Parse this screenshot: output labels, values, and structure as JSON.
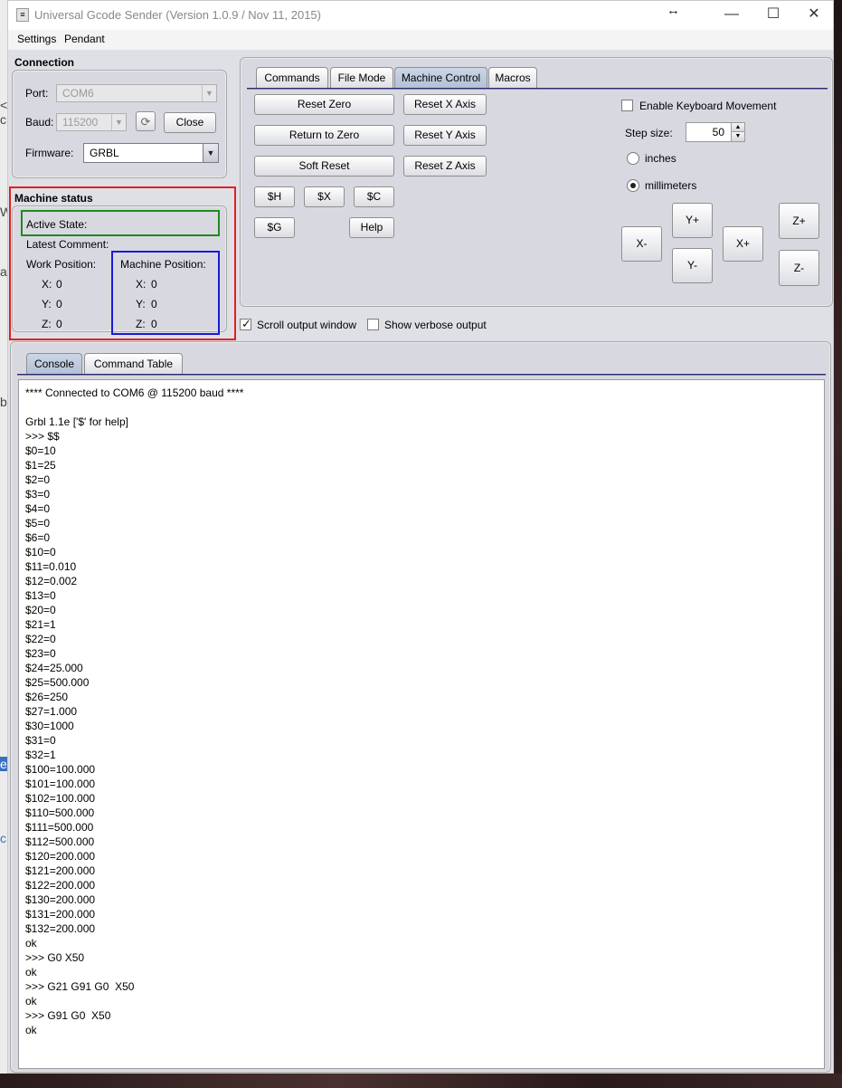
{
  "window": {
    "title": "Universal Gcode Sender (Version 1.0.9 / Nov 11, 2015)",
    "app_icon": "gcode-sender-app-icon",
    "controls": {
      "resize_glyph": "↔",
      "minimize": "—",
      "maximize": "☐",
      "close": "✕"
    }
  },
  "menu": {
    "items": [
      "Settings",
      "Pendant"
    ]
  },
  "connection": {
    "title": "Connection",
    "port_label": "Port:",
    "port_value": "COM6",
    "baud_label": "Baud:",
    "baud_value": "115200",
    "refresh_icon": "refresh-icon",
    "close_button": "Close",
    "firmware_label": "Firmware:",
    "firmware_value": "GRBL"
  },
  "machine_status": {
    "title": "Machine status",
    "active_state_label": "Active State:",
    "latest_comment_label": "Latest Comment:",
    "work_position_label": "Work Position:",
    "machine_position_label": "Machine Position:",
    "work": {
      "x_label": "X:",
      "x": "0",
      "y_label": "Y:",
      "y": "0",
      "z_label": "Z:",
      "z": "0"
    },
    "machine": {
      "x_label": "X:",
      "x": "0",
      "y_label": "Y:",
      "y": "0",
      "z_label": "Z:",
      "z": "0"
    }
  },
  "control_tabs": [
    "Commands",
    "File Mode",
    "Machine Control",
    "Macros"
  ],
  "machine_control": {
    "reset_zero": "Reset Zero",
    "return_to_zero": "Return to Zero",
    "soft_reset": "Soft Reset",
    "reset_x": "Reset X Axis",
    "reset_y": "Reset Y Axis",
    "reset_z": "Reset Z Axis",
    "cmd_h": "$H",
    "cmd_x": "$X",
    "cmd_c": "$C",
    "cmd_g": "$G",
    "help": "Help",
    "enable_keyboard": "Enable Keyboard Movement",
    "step_size_label": "Step size:",
    "step_size_value": "50",
    "unit_inches": "inches",
    "unit_mm": "millimeters",
    "jog": {
      "x_minus": "X-",
      "x_plus": "X+",
      "y_plus": "Y+",
      "y_minus": "Y-",
      "z_plus": "Z+",
      "z_minus": "Z-"
    }
  },
  "output_options": {
    "scroll_output": "Scroll output window",
    "verbose_output": "Show verbose output"
  },
  "console_tabs": [
    "Console",
    "Command Table"
  ],
  "console_lines": [
    "**** Connected to COM6 @ 115200 baud ****",
    "",
    "Grbl 1.1e ['$' for help]",
    ">>> $$",
    "$0=10",
    "$1=25",
    "$2=0",
    "$3=0",
    "$4=0",
    "$5=0",
    "$6=0",
    "$10=0",
    "$11=0.010",
    "$12=0.002",
    "$13=0",
    "$20=0",
    "$21=1",
    "$22=0",
    "$23=0",
    "$24=25.000",
    "$25=500.000",
    "$26=250",
    "$27=1.000",
    "$30=1000",
    "$31=0",
    "$32=1",
    "$100=100.000",
    "$101=100.000",
    "$102=100.000",
    "$110=500.000",
    "$111=500.000",
    "$112=500.000",
    "$120=200.000",
    "$121=200.000",
    "$122=200.000",
    "$130=200.000",
    "$131=200.000",
    "$132=200.000",
    "ok",
    ">>> G0 X50",
    "ok",
    ">>> G21 G91 G0  X50",
    "ok",
    ">>> G91 G0  X50",
    "ok"
  ],
  "background_fragments": [
    "< c",
    "W",
    "a",
    "b",
    "er",
    "c"
  ]
}
